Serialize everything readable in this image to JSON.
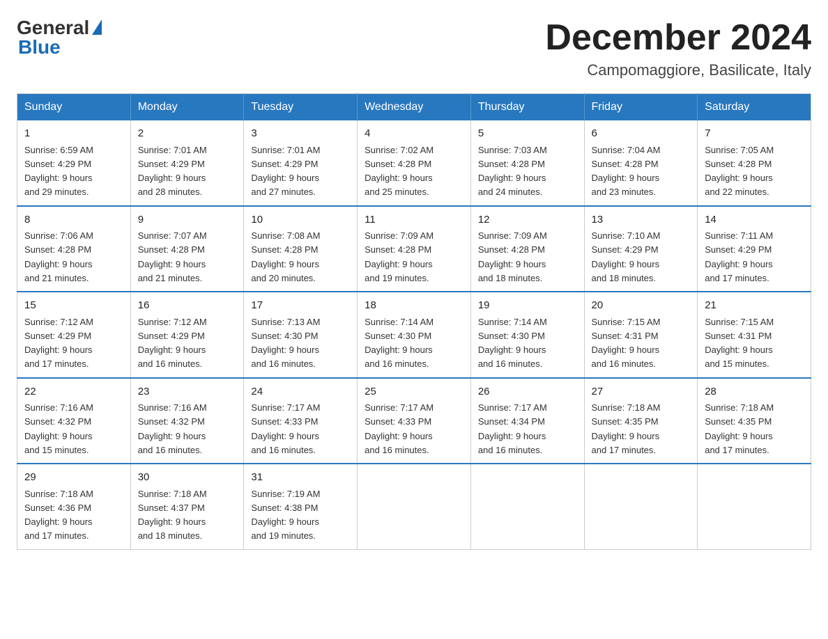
{
  "logo": {
    "general_text": "General",
    "blue_text": "Blue"
  },
  "title": {
    "month_year": "December 2024",
    "location": "Campomaggiore, Basilicate, Italy"
  },
  "days_of_week": [
    "Sunday",
    "Monday",
    "Tuesday",
    "Wednesday",
    "Thursday",
    "Friday",
    "Saturday"
  ],
  "weeks": [
    [
      {
        "day": "1",
        "sunrise": "6:59 AM",
        "sunset": "4:29 PM",
        "daylight": "9 hours and 29 minutes."
      },
      {
        "day": "2",
        "sunrise": "7:01 AM",
        "sunset": "4:29 PM",
        "daylight": "9 hours and 28 minutes."
      },
      {
        "day": "3",
        "sunrise": "7:01 AM",
        "sunset": "4:29 PM",
        "daylight": "9 hours and 27 minutes."
      },
      {
        "day": "4",
        "sunrise": "7:02 AM",
        "sunset": "4:28 PM",
        "daylight": "9 hours and 25 minutes."
      },
      {
        "day": "5",
        "sunrise": "7:03 AM",
        "sunset": "4:28 PM",
        "daylight": "9 hours and 24 minutes."
      },
      {
        "day": "6",
        "sunrise": "7:04 AM",
        "sunset": "4:28 PM",
        "daylight": "9 hours and 23 minutes."
      },
      {
        "day": "7",
        "sunrise": "7:05 AM",
        "sunset": "4:28 PM",
        "daylight": "9 hours and 22 minutes."
      }
    ],
    [
      {
        "day": "8",
        "sunrise": "7:06 AM",
        "sunset": "4:28 PM",
        "daylight": "9 hours and 21 minutes."
      },
      {
        "day": "9",
        "sunrise": "7:07 AM",
        "sunset": "4:28 PM",
        "daylight": "9 hours and 21 minutes."
      },
      {
        "day": "10",
        "sunrise": "7:08 AM",
        "sunset": "4:28 PM",
        "daylight": "9 hours and 20 minutes."
      },
      {
        "day": "11",
        "sunrise": "7:09 AM",
        "sunset": "4:28 PM",
        "daylight": "9 hours and 19 minutes."
      },
      {
        "day": "12",
        "sunrise": "7:09 AM",
        "sunset": "4:28 PM",
        "daylight": "9 hours and 18 minutes."
      },
      {
        "day": "13",
        "sunrise": "7:10 AM",
        "sunset": "4:29 PM",
        "daylight": "9 hours and 18 minutes."
      },
      {
        "day": "14",
        "sunrise": "7:11 AM",
        "sunset": "4:29 PM",
        "daylight": "9 hours and 17 minutes."
      }
    ],
    [
      {
        "day": "15",
        "sunrise": "7:12 AM",
        "sunset": "4:29 PM",
        "daylight": "9 hours and 17 minutes."
      },
      {
        "day": "16",
        "sunrise": "7:12 AM",
        "sunset": "4:29 PM",
        "daylight": "9 hours and 16 minutes."
      },
      {
        "day": "17",
        "sunrise": "7:13 AM",
        "sunset": "4:30 PM",
        "daylight": "9 hours and 16 minutes."
      },
      {
        "day": "18",
        "sunrise": "7:14 AM",
        "sunset": "4:30 PM",
        "daylight": "9 hours and 16 minutes."
      },
      {
        "day": "19",
        "sunrise": "7:14 AM",
        "sunset": "4:30 PM",
        "daylight": "9 hours and 16 minutes."
      },
      {
        "day": "20",
        "sunrise": "7:15 AM",
        "sunset": "4:31 PM",
        "daylight": "9 hours and 16 minutes."
      },
      {
        "day": "21",
        "sunrise": "7:15 AM",
        "sunset": "4:31 PM",
        "daylight": "9 hours and 15 minutes."
      }
    ],
    [
      {
        "day": "22",
        "sunrise": "7:16 AM",
        "sunset": "4:32 PM",
        "daylight": "9 hours and 15 minutes."
      },
      {
        "day": "23",
        "sunrise": "7:16 AM",
        "sunset": "4:32 PM",
        "daylight": "9 hours and 16 minutes."
      },
      {
        "day": "24",
        "sunrise": "7:17 AM",
        "sunset": "4:33 PM",
        "daylight": "9 hours and 16 minutes."
      },
      {
        "day": "25",
        "sunrise": "7:17 AM",
        "sunset": "4:33 PM",
        "daylight": "9 hours and 16 minutes."
      },
      {
        "day": "26",
        "sunrise": "7:17 AM",
        "sunset": "4:34 PM",
        "daylight": "9 hours and 16 minutes."
      },
      {
        "day": "27",
        "sunrise": "7:18 AM",
        "sunset": "4:35 PM",
        "daylight": "9 hours and 17 minutes."
      },
      {
        "day": "28",
        "sunrise": "7:18 AM",
        "sunset": "4:35 PM",
        "daylight": "9 hours and 17 minutes."
      }
    ],
    [
      {
        "day": "29",
        "sunrise": "7:18 AM",
        "sunset": "4:36 PM",
        "daylight": "9 hours and 17 minutes."
      },
      {
        "day": "30",
        "sunrise": "7:18 AM",
        "sunset": "4:37 PM",
        "daylight": "9 hours and 18 minutes."
      },
      {
        "day": "31",
        "sunrise": "7:19 AM",
        "sunset": "4:38 PM",
        "daylight": "9 hours and 19 minutes."
      },
      null,
      null,
      null,
      null
    ]
  ],
  "labels": {
    "sunrise": "Sunrise:",
    "sunset": "Sunset:",
    "daylight": "Daylight:"
  }
}
